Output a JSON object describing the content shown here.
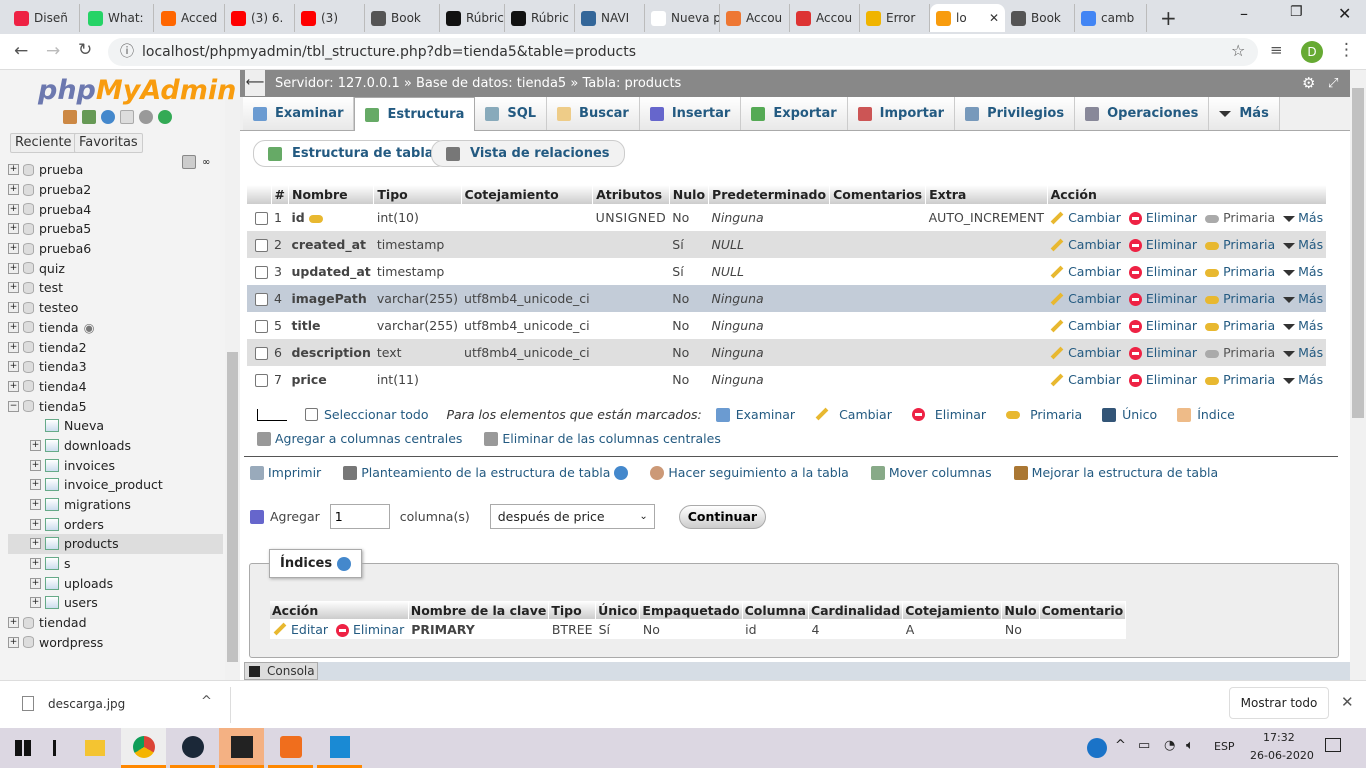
{
  "browser": {
    "tabs": [
      {
        "label": "Diseñ",
        "color": "#e24"
      },
      {
        "label": "What:",
        "color": "#25d366"
      },
      {
        "label": "Acced",
        "color": "#f60"
      },
      {
        "label": "(3) 6.",
        "color": "#f00"
      },
      {
        "label": "(3)",
        "color": "#f00"
      },
      {
        "label": "Book",
        "color": "#555"
      },
      {
        "label": "Rúbric",
        "color": "#111"
      },
      {
        "label": "Rúbric",
        "color": "#111"
      },
      {
        "label": "NAVI",
        "color": "#369"
      },
      {
        "label": "Nueva pes",
        "color": "#fff"
      },
      {
        "label": "Accou",
        "color": "#e73"
      },
      {
        "label": "Accou",
        "color": "#d33"
      },
      {
        "label": "Error",
        "color": "#f0b400"
      },
      {
        "label": "lo",
        "color": "#f89c0e",
        "active": true
      },
      {
        "label": "Book",
        "color": "#555"
      },
      {
        "label": "camb",
        "color": "#4285f4"
      }
    ],
    "url": "localhost/phpmyadmin/tbl_structure.php?db=tienda5&table=products",
    "profile_initial": "D"
  },
  "sidebar": {
    "logo_php": "php",
    "logo_myadmin": "MyAdmin",
    "recent": "Reciente",
    "favorites": "Favoritas",
    "tree": [
      {
        "label": "prueba",
        "type": "db"
      },
      {
        "label": "prueba2",
        "type": "db"
      },
      {
        "label": "prueba4",
        "type": "db"
      },
      {
        "label": "prueba5",
        "type": "db"
      },
      {
        "label": "prueba6",
        "type": "db"
      },
      {
        "label": "quiz",
        "type": "db"
      },
      {
        "label": "test",
        "type": "db"
      },
      {
        "label": "testeo",
        "type": "db"
      },
      {
        "label": "tienda",
        "type": "db"
      },
      {
        "label": "tienda2",
        "type": "db"
      },
      {
        "label": "tienda3",
        "type": "db"
      },
      {
        "label": "tienda4",
        "type": "db"
      },
      {
        "label": "tienda5",
        "type": "db",
        "expanded": true
      },
      {
        "label": "Nueva",
        "type": "new"
      },
      {
        "label": "downloads",
        "type": "table"
      },
      {
        "label": "invoices",
        "type": "table"
      },
      {
        "label": "invoice_product",
        "type": "table"
      },
      {
        "label": "migrations",
        "type": "table"
      },
      {
        "label": "orders",
        "type": "table"
      },
      {
        "label": "products",
        "type": "table",
        "selected": true
      },
      {
        "label": "s",
        "type": "table"
      },
      {
        "label": "uploads",
        "type": "table"
      },
      {
        "label": "users",
        "type": "table"
      },
      {
        "label": "tiendad",
        "type": "db"
      },
      {
        "label": "wordpress",
        "type": "db"
      }
    ]
  },
  "breadcrumb": {
    "server": "Servidor: 127.0.0.1",
    "sep": "»",
    "database": "Base de datos: tienda5",
    "table": "Tabla: products"
  },
  "menu": [
    {
      "label": "Examinar",
      "color": "#6b9bd1"
    },
    {
      "label": "Estructura",
      "color": "#6a6",
      "active": true
    },
    {
      "label": "SQL",
      "color": "#8ab"
    },
    {
      "label": "Buscar",
      "color": "#ec8"
    },
    {
      "label": "Insertar",
      "color": "#66c"
    },
    {
      "label": "Exportar",
      "color": "#5a5"
    },
    {
      "label": "Importar",
      "color": "#c55"
    },
    {
      "label": "Privilegios",
      "color": "#79b"
    },
    {
      "label": "Operaciones",
      "color": "#889"
    },
    {
      "label": "Más",
      "color": "#333"
    }
  ],
  "subtabs": {
    "structure": "Estructura de tabla",
    "relations": "Vista de relaciones"
  },
  "structure": {
    "headers": [
      "#",
      "Nombre",
      "Tipo",
      "Cotejamiento",
      "Atributos",
      "Nulo",
      "Predeterminado",
      "Comentarios",
      "Extra",
      "Acción"
    ],
    "rows": [
      {
        "n": "1",
        "name": "id",
        "type": "int(10)",
        "collation": "",
        "attributes": "UNSIGNED",
        "null": "No",
        "default": "Ninguna",
        "comments": "",
        "extra": "AUTO_INCREMENT",
        "primary_enabled": false,
        "is_key": true
      },
      {
        "n": "2",
        "name": "created_at",
        "type": "timestamp",
        "collation": "",
        "attributes": "",
        "null": "Sí",
        "default": "NULL",
        "comments": "",
        "extra": "",
        "primary_enabled": true
      },
      {
        "n": "3",
        "name": "updated_at",
        "type": "timestamp",
        "collation": "",
        "attributes": "",
        "null": "Sí",
        "default": "NULL",
        "comments": "",
        "extra": "",
        "primary_enabled": true
      },
      {
        "n": "4",
        "name": "imagePath",
        "type": "varchar(255)",
        "collation": "utf8mb4_unicode_ci",
        "attributes": "",
        "null": "No",
        "default": "Ninguna",
        "comments": "",
        "extra": "",
        "primary_enabled": true,
        "highlighted": true
      },
      {
        "n": "5",
        "name": "title",
        "type": "varchar(255)",
        "collation": "utf8mb4_unicode_ci",
        "attributes": "",
        "null": "No",
        "default": "Ninguna",
        "comments": "",
        "extra": "",
        "primary_enabled": true
      },
      {
        "n": "6",
        "name": "description",
        "type": "text",
        "collation": "utf8mb4_unicode_ci",
        "attributes": "",
        "null": "No",
        "default": "Ninguna",
        "comments": "",
        "extra": "",
        "primary_enabled": false
      },
      {
        "n": "7",
        "name": "price",
        "type": "int(11)",
        "collation": "",
        "attributes": "",
        "null": "No",
        "default": "Ninguna",
        "comments": "",
        "extra": "",
        "primary_enabled": true
      }
    ],
    "actions": {
      "change": "Cambiar",
      "drop": "Eliminar",
      "primary": "Primaria",
      "more": "Más"
    }
  },
  "bulk": {
    "select_all": "Seleccionar todo",
    "with_selected": "Para los elementos que están marcados:",
    "browse": "Examinar",
    "change": "Cambiar",
    "drop": "Eliminar",
    "primary": "Primaria",
    "unique": "Único",
    "index": "Índice",
    "add_central": "Agregar a columnas centrales",
    "remove_central": "Eliminar de las columnas centrales"
  },
  "links": {
    "print": "Imprimir",
    "propose": "Planteamiento de la estructura de tabla",
    "track": "Hacer seguimiento a la tabla",
    "move": "Mover columnas",
    "improve": "Mejorar la estructura de tabla"
  },
  "add_column": {
    "label": "Agregar",
    "count": "1",
    "unit": "columna(s)",
    "position": "después de price",
    "submit": "Continuar"
  },
  "indexes": {
    "title": "Índices",
    "headers": [
      "Acción",
      "Nombre de la clave",
      "Tipo",
      "Único",
      "Empaquetado",
      "Columna",
      "Cardinalidad",
      "Cotejamiento",
      "Nulo",
      "Comentario"
    ],
    "edit": "Editar",
    "drop": "Eliminar",
    "row": {
      "name": "PRIMARY",
      "type": "BTREE",
      "unique": "Sí",
      "packed": "No",
      "column": "id",
      "cardinality": "4",
      "collation": "A",
      "null": "No",
      "comment": ""
    }
  },
  "console": "Consola",
  "download": {
    "file": "descarga.jpg",
    "show_all": "Mostrar todo"
  },
  "taskbar": {
    "time": "17:32",
    "date": "26-06-2020",
    "lang": "ESP"
  }
}
